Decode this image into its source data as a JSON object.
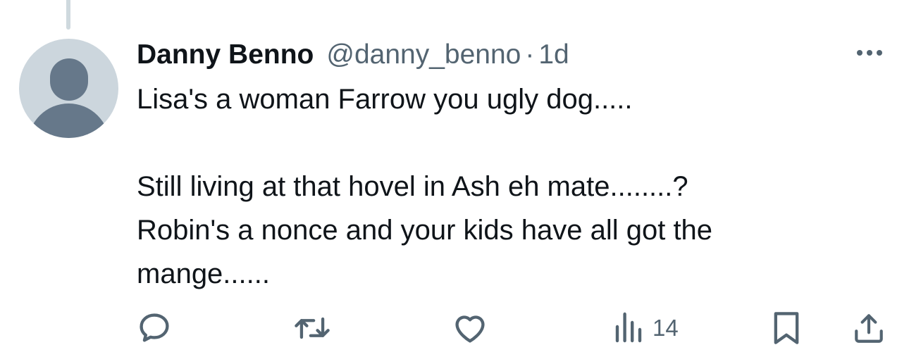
{
  "tweet": {
    "author_name": "Danny Benno",
    "handle": "@danny_benno",
    "separator": "·",
    "time": "1d",
    "lines": [
      "Lisa's a woman Farrow you ugly dog.....",
      "",
      "Still living at that hovel in Ash eh mate........?",
      "Robin's a nonce and your kids have all got the",
      "mange......"
    ]
  },
  "actions": {
    "reply_icon": "reply-icon",
    "retweet_icon": "retweet-icon",
    "like_icon": "like-icon",
    "views_icon": "views-icon",
    "views_count": "14",
    "bookmark_icon": "bookmark-icon",
    "share_icon": "share-icon"
  },
  "colors": {
    "text": "#0f1419",
    "secondary": "#536471",
    "avatar_bg": "#ccd6dd",
    "avatar_fg": "#66788a",
    "thread_line": "#cfd9de"
  }
}
